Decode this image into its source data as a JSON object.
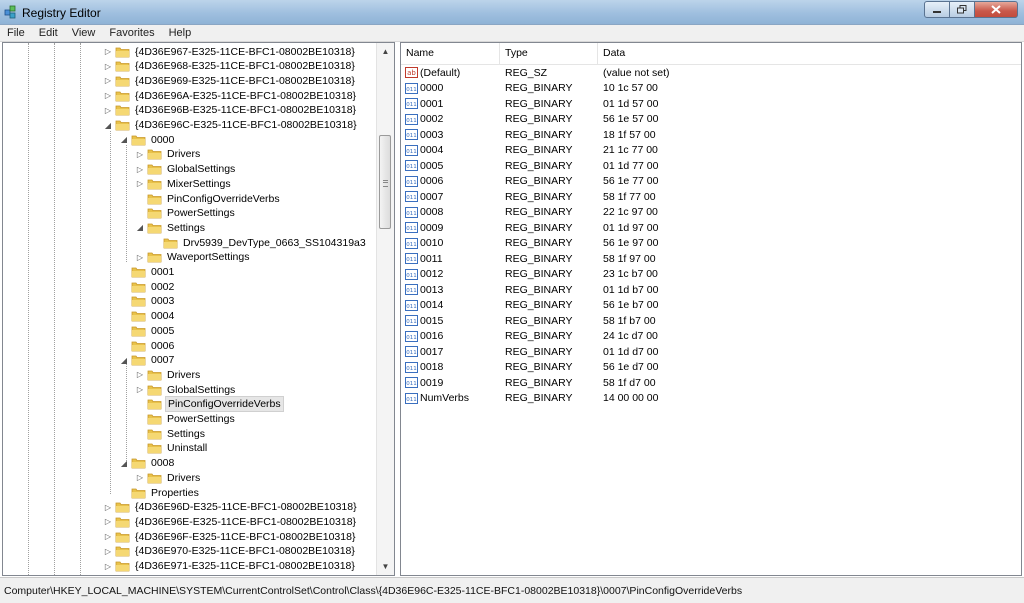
{
  "window": {
    "title": "Registry Editor"
  },
  "menu": [
    "File",
    "Edit",
    "View",
    "Favorites",
    "Help"
  ],
  "tree": [
    {
      "label": "{4D36E967-E325-11CE-BFC1-08002BE10318}",
      "level": 0,
      "expander": "collapsed",
      "icon": "folder"
    },
    {
      "label": "{4D36E968-E325-11CE-BFC1-08002BE10318}",
      "level": 0,
      "expander": "collapsed",
      "icon": "folder"
    },
    {
      "label": "{4D36E969-E325-11CE-BFC1-08002BE10318}",
      "level": 0,
      "expander": "collapsed",
      "icon": "folder"
    },
    {
      "label": "{4D36E96A-E325-11CE-BFC1-08002BE10318}",
      "level": 0,
      "expander": "collapsed",
      "icon": "folder"
    },
    {
      "label": "{4D36E96B-E325-11CE-BFC1-08002BE10318}",
      "level": 0,
      "expander": "collapsed",
      "icon": "folder"
    },
    {
      "label": "{4D36E96C-E325-11CE-BFC1-08002BE10318}",
      "level": 0,
      "expander": "expanded",
      "icon": "folder"
    },
    {
      "label": "0000",
      "level": 1,
      "expander": "expanded",
      "icon": "folder"
    },
    {
      "label": "Drivers",
      "level": 2,
      "expander": "collapsed",
      "icon": "folder"
    },
    {
      "label": "GlobalSettings",
      "level": 2,
      "expander": "collapsed",
      "icon": "folder"
    },
    {
      "label": "MixerSettings",
      "level": 2,
      "expander": "collapsed",
      "icon": "folder"
    },
    {
      "label": "PinConfigOverrideVerbs",
      "level": 2,
      "expander": "none",
      "icon": "folder"
    },
    {
      "label": "PowerSettings",
      "level": 2,
      "expander": "none",
      "icon": "folder"
    },
    {
      "label": "Settings",
      "level": 2,
      "expander": "expanded",
      "icon": "folder"
    },
    {
      "label": "Drv5939_DevType_0663_SS104319a3",
      "level": 3,
      "expander": "none",
      "icon": "folder"
    },
    {
      "label": "WaveportSettings",
      "level": 2,
      "expander": "collapsed",
      "icon": "folder"
    },
    {
      "label": "0001",
      "level": 1,
      "expander": "none",
      "icon": "folder"
    },
    {
      "label": "0002",
      "level": 1,
      "expander": "none",
      "icon": "folder"
    },
    {
      "label": "0003",
      "level": 1,
      "expander": "none",
      "icon": "folder"
    },
    {
      "label": "0004",
      "level": 1,
      "expander": "none",
      "icon": "folder"
    },
    {
      "label": "0005",
      "level": 1,
      "expander": "none",
      "icon": "folder"
    },
    {
      "label": "0006",
      "level": 1,
      "expander": "none",
      "icon": "folder"
    },
    {
      "label": "0007",
      "level": 1,
      "expander": "expanded",
      "icon": "folder"
    },
    {
      "label": "Drivers",
      "level": 2,
      "expander": "collapsed",
      "icon": "folder"
    },
    {
      "label": "GlobalSettings",
      "level": 2,
      "expander": "collapsed",
      "icon": "folder"
    },
    {
      "label": "PinConfigOverrideVerbs",
      "level": 2,
      "expander": "none",
      "icon": "folder",
      "selected": true
    },
    {
      "label": "PowerSettings",
      "level": 2,
      "expander": "none",
      "icon": "folder"
    },
    {
      "label": "Settings",
      "level": 2,
      "expander": "none",
      "icon": "folder"
    },
    {
      "label": "Uninstall",
      "level": 2,
      "expander": "none",
      "icon": "folder"
    },
    {
      "label": "0008",
      "level": 1,
      "expander": "expanded",
      "icon": "folder"
    },
    {
      "label": "Drivers",
      "level": 2,
      "expander": "collapsed",
      "icon": "folder"
    },
    {
      "label": "Properties",
      "level": 1,
      "expander": "none",
      "icon": "folder"
    },
    {
      "label": "{4D36E96D-E325-11CE-BFC1-08002BE10318}",
      "level": 0,
      "expander": "collapsed",
      "icon": "folder"
    },
    {
      "label": "{4D36E96E-E325-11CE-BFC1-08002BE10318}",
      "level": 0,
      "expander": "collapsed",
      "icon": "folder"
    },
    {
      "label": "{4D36E96F-E325-11CE-BFC1-08002BE10318}",
      "level": 0,
      "expander": "collapsed",
      "icon": "folder"
    },
    {
      "label": "{4D36E970-E325-11CE-BFC1-08002BE10318}",
      "level": 0,
      "expander": "collapsed",
      "icon": "folder"
    },
    {
      "label": "{4D36E971-E325-11CE-BFC1-08002BE10318}",
      "level": 0,
      "expander": "collapsed",
      "icon": "folder"
    }
  ],
  "list": {
    "columns": [
      "Name",
      "Type",
      "Data"
    ],
    "rows": [
      {
        "name": "(Default)",
        "type": "REG_SZ",
        "data": "(value not set)",
        "icon": "string-value-icon"
      },
      {
        "name": "0000",
        "type": "REG_BINARY",
        "data": "10 1c 57 00",
        "icon": "binary-value-icon"
      },
      {
        "name": "0001",
        "type": "REG_BINARY",
        "data": "01 1d 57 00",
        "icon": "binary-value-icon"
      },
      {
        "name": "0002",
        "type": "REG_BINARY",
        "data": "56 1e 57 00",
        "icon": "binary-value-icon"
      },
      {
        "name": "0003",
        "type": "REG_BINARY",
        "data": "18 1f 57 00",
        "icon": "binary-value-icon"
      },
      {
        "name": "0004",
        "type": "REG_BINARY",
        "data": "21 1c 77 00",
        "icon": "binary-value-icon"
      },
      {
        "name": "0005",
        "type": "REG_BINARY",
        "data": "01 1d 77 00",
        "icon": "binary-value-icon"
      },
      {
        "name": "0006",
        "type": "REG_BINARY",
        "data": "56 1e 77 00",
        "icon": "binary-value-icon"
      },
      {
        "name": "0007",
        "type": "REG_BINARY",
        "data": "58 1f 77 00",
        "icon": "binary-value-icon"
      },
      {
        "name": "0008",
        "type": "REG_BINARY",
        "data": "22 1c 97 00",
        "icon": "binary-value-icon"
      },
      {
        "name": "0009",
        "type": "REG_BINARY",
        "data": "01 1d 97 00",
        "icon": "binary-value-icon"
      },
      {
        "name": "0010",
        "type": "REG_BINARY",
        "data": "56 1e 97 00",
        "icon": "binary-value-icon"
      },
      {
        "name": "0011",
        "type": "REG_BINARY",
        "data": "58 1f 97 00",
        "icon": "binary-value-icon"
      },
      {
        "name": "0012",
        "type": "REG_BINARY",
        "data": "23 1c b7 00",
        "icon": "binary-value-icon"
      },
      {
        "name": "0013",
        "type": "REG_BINARY",
        "data": "01 1d b7 00",
        "icon": "binary-value-icon"
      },
      {
        "name": "0014",
        "type": "REG_BINARY",
        "data": "56 1e b7 00",
        "icon": "binary-value-icon"
      },
      {
        "name": "0015",
        "type": "REG_BINARY",
        "data": "58 1f b7 00",
        "icon": "binary-value-icon"
      },
      {
        "name": "0016",
        "type": "REG_BINARY",
        "data": "24 1c d7 00",
        "icon": "binary-value-icon"
      },
      {
        "name": "0017",
        "type": "REG_BINARY",
        "data": "01 1d d7 00",
        "icon": "binary-value-icon"
      },
      {
        "name": "0018",
        "type": "REG_BINARY",
        "data": "56 1e d7 00",
        "icon": "binary-value-icon"
      },
      {
        "name": "0019",
        "type": "REG_BINARY",
        "data": "58 1f d7 00",
        "icon": "binary-value-icon"
      },
      {
        "name": "NumVerbs",
        "type": "REG_BINARY",
        "data": "14 00 00 00",
        "icon": "binary-value-icon"
      }
    ]
  },
  "status": {
    "path": "Computer\\HKEY_LOCAL_MACHINE\\SYSTEM\\CurrentControlSet\\Control\\Class\\{4D36E96C-E325-11CE-BFC1-08002BE10318}\\0007\\PinConfigOverrideVerbs"
  },
  "colors": {
    "folder": "#e8c24a",
    "folder_dark": "#c9982a",
    "binary_icon": "#3a6fbf",
    "string_icon": "#c0392b"
  }
}
